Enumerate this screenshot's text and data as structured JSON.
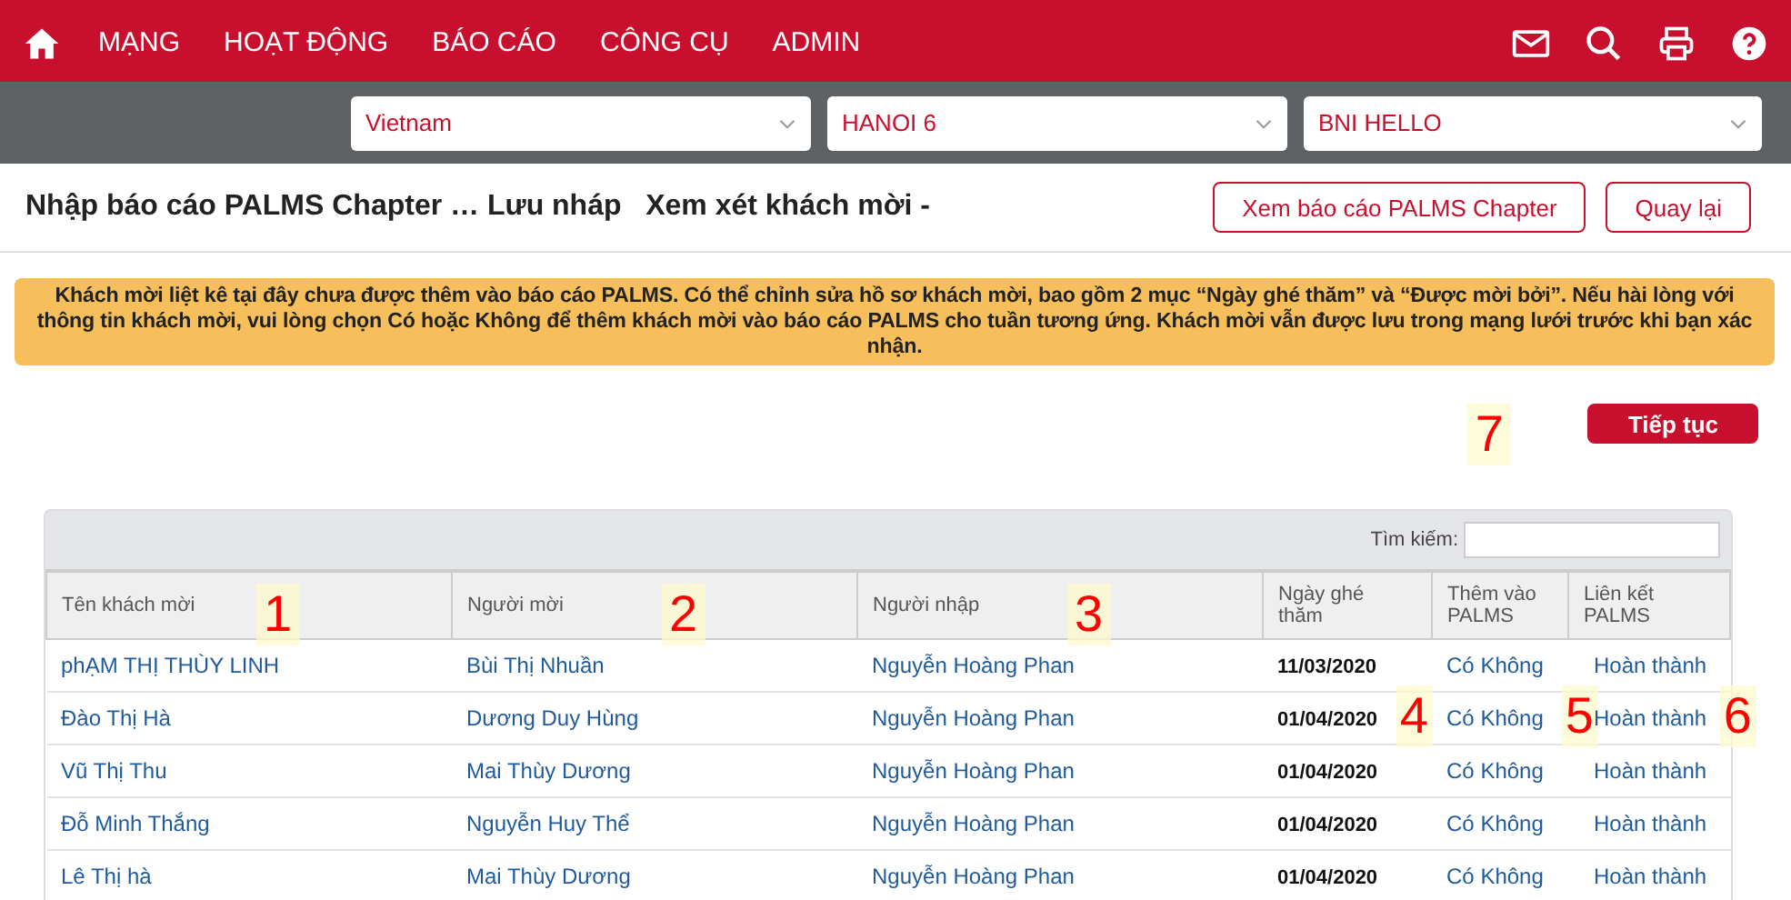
{
  "nav": {
    "items": [
      "MẠNG",
      "HOẠT ĐỘNG",
      "BÁO CÁO",
      "CÔNG CỤ",
      "ADMIN"
    ]
  },
  "filters": [
    {
      "value": "Vietnam"
    },
    {
      "value": "HANOI 6"
    },
    {
      "value": "BNI HELLO"
    }
  ],
  "page": {
    "title": "Nhập báo cáo PALMS Chapter … Lưu nháp   Xem xét khách mời -",
    "buttons": [
      "Xem báo cáo PALMS Chapter",
      "Quay lại"
    ]
  },
  "notice": "Khách mời liệt kê tại đây chưa được thêm vào báo cáo PALMS. Có thể chỉnh sửa hồ sơ khách mời, bao gồm 2 mục “Ngày ghé thăm” và “Được mời bởi”. Nếu hài lòng với thông tin khách mời, vui lòng chọn Có hoặc Không để thêm khách mời vào báo cáo PALMS cho tuần tương ứng. Khách mời vẫn được lưu trong mạng lưới trước khi bạn xác nhận.",
  "continue_button": {
    "label": "Tiếp tục",
    "marker": "7"
  },
  "table": {
    "search_label": "Tìm kiếm:",
    "columns": [
      {
        "label": "Tên khách mời",
        "marker": "1"
      },
      {
        "label": "Người mời",
        "marker": "2"
      },
      {
        "label": "Người nhập",
        "marker": "3"
      },
      {
        "label": "Ngày ghé thăm"
      },
      {
        "label": "Thêm vào PALMS"
      },
      {
        "label": "Liên kết PALMS"
      }
    ],
    "rows": [
      {
        "guest": "phẠM THỊ THÙY LINH",
        "inviter": "Bùi Thị Nhuần",
        "entered_by": "Nguyễn Hoàng Phan",
        "date": "11/03/2020",
        "add_yes": "Có",
        "add_no": "Không",
        "link": "Hoàn thành"
      },
      {
        "guest": "Đào Thị Hà",
        "inviter": "Dương Duy Hùng",
        "entered_by": "Nguyễn Hoàng Phan",
        "date": "01/04/2020",
        "add_yes": "Có",
        "add_no": "Không",
        "link": "Hoàn thành",
        "markers": {
          "date": "4",
          "add": "5",
          "link": "6"
        }
      },
      {
        "guest": "Vũ Thị Thu",
        "inviter": "Mai Thùy Dương",
        "entered_by": "Nguyễn Hoàng Phan",
        "date": "01/04/2020",
        "add_yes": "Có",
        "add_no": "Không",
        "link": "Hoàn thành"
      },
      {
        "guest": "Đỗ Minh Thắng",
        "inviter": "Nguyễn Huy Thể",
        "entered_by": "Nguyễn Hoàng Phan",
        "date": "01/04/2020",
        "add_yes": "Có",
        "add_no": "Không",
        "link": "Hoàn thành"
      },
      {
        "guest": "Lê Thị hà",
        "inviter": "Mai Thùy Dương",
        "entered_by": "Nguyễn Hoàng Phan",
        "date": "01/04/2020",
        "add_yes": "Có",
        "add_no": "Không",
        "link": "Hoàn thành"
      }
    ]
  }
}
